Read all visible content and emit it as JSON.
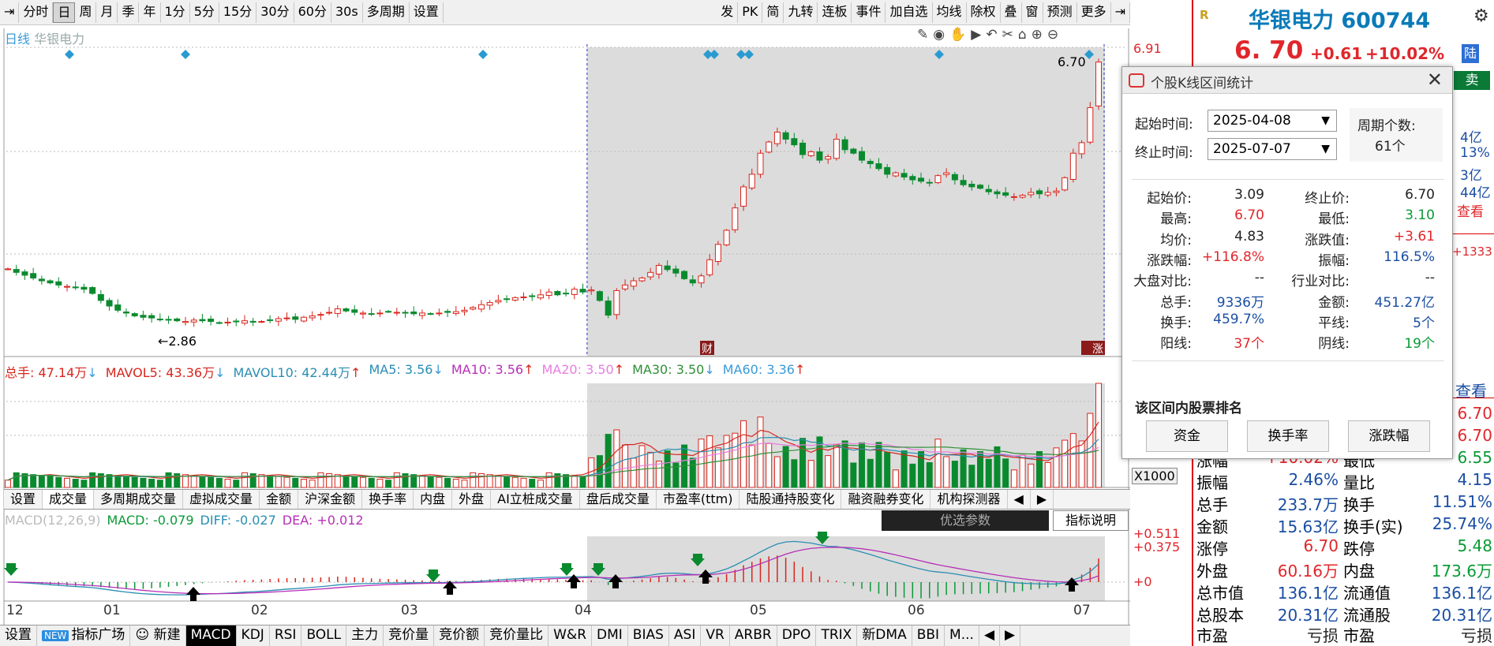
{
  "toolbar": {
    "left": [
      "分时",
      "日",
      "周",
      "月",
      "季",
      "年",
      "1分",
      "5分",
      "15分",
      "30分",
      "60分",
      "30s",
      "多周期",
      "设置"
    ],
    "right": [
      "发",
      "PK",
      "简",
      "九转",
      "连板",
      "事件",
      "加自选",
      "均线",
      "除权",
      "叠",
      "窗",
      "预测",
      "更多"
    ]
  },
  "chart": {
    "period_label": "日线",
    "stock_label": "华银电力",
    "low_marker": "2.86",
    "high_marker": "6.70",
    "cai_label": "财",
    "zhang_label": "涨"
  },
  "price_axis": {
    "top": "6.91",
    "vol_mult": "X1000",
    "macd_hi": "+0.511",
    "macd_mid": "+0.375",
    "macd_zero": "+0"
  },
  "vol_legend": [
    {
      "t": "总手: 47.14万",
      "c": "#d9251c",
      "arrow": "↓",
      "ac": "#3a9ad9"
    },
    {
      "t": "MAVOL5: 43.36万",
      "c": "#d9251c",
      "arrow": "↓",
      "ac": "#3a9ad9"
    },
    {
      "t": "MAVOL10: 42.44万",
      "c": "#2a8eb3",
      "arrow": "↑",
      "ac": "#d9251c"
    },
    {
      "t": "MA5: 3.56",
      "c": "#2a8eb3",
      "arrow": "↓",
      "ac": "#3a9ad9"
    },
    {
      "t": "MA10: 3.56",
      "c": "#b72fb7",
      "arrow": "↑",
      "ac": "#d9251c"
    },
    {
      "t": "MA20: 3.50",
      "c": "#e77ee0",
      "arrow": "↑",
      "ac": "#d9251c"
    },
    {
      "t": "MA30: 3.50",
      "c": "#2f8f37",
      "arrow": "↓",
      "ac": "#3a9ad9"
    },
    {
      "t": "MA60: 3.36",
      "c": "#3a9ad9",
      "arrow": "↑",
      "ac": "#d9251c"
    }
  ],
  "indicator_tabs": [
    "设置",
    "成交量",
    "多周期成交量",
    "虚拟成交量",
    "金额",
    "沪深金额",
    "换手率",
    "内盘",
    "外盘",
    "AI立桩成交量",
    "盘后成交量",
    "市盈率(ttm)",
    "陆股通持股变化",
    "融资融券变化",
    "机构探测器"
  ],
  "macd_legend": {
    "name": "MACD(12,26,9)",
    "macd": "MACD: -0.079",
    "diff": "DIFF: -0.027",
    "dea": "DEA: +0.012"
  },
  "macd_params": "优选参数",
  "macd_explain": "指标说明",
  "time_axis": [
    "12",
    "01",
    "02",
    "03",
    "04",
    "05",
    "06",
    "07"
  ],
  "bottom_tabs": [
    "设置",
    "指标广场",
    "新建",
    "MACD",
    "KDJ",
    "RSI",
    "BOLL",
    "主力",
    "竞价量",
    "竞价额",
    "竞价量比",
    "W&R",
    "DMI",
    "BIAS",
    "ASI",
    "VR",
    "ARBR",
    "DPO",
    "TRIX",
    "新DMA",
    "BBI",
    "M..."
  ],
  "new_badge": "NEW",
  "stock": {
    "name": "华银电力 600744",
    "badge": "R",
    "price": "6. 70",
    "change": "+0.61",
    "change_pct": "+10.02%",
    "exchange": "陆",
    "sell": "卖"
  },
  "quote_partial": [
    "4亿",
    "13%",
    "3亿",
    "44亿",
    "查看",
    "+1333",
    "查看"
  ],
  "quote_rows": [
    {
      "l1": "",
      "v1": "",
      "l2": "",
      "v2": "6.70"
    },
    {
      "l1": "",
      "v1": "",
      "l2": "",
      "v2": "6.70"
    },
    {
      "l1": "涨幅",
      "v1": "+10.02%",
      "l2": "最低",
      "v2": "6.55"
    },
    {
      "l1": "振幅",
      "v1": "2.46%",
      "l2": "量比",
      "v2": "4.15"
    },
    {
      "l1": "总手",
      "v1": "233.7万",
      "l2": "换手",
      "v2": "11.51%"
    },
    {
      "l1": "金额",
      "v1": "15.63亿",
      "l2": "换手(实)",
      "v2": "25.74%"
    },
    {
      "l1": "涨停",
      "v1": "6.70",
      "l2": "跌停",
      "v2": "5.48"
    },
    {
      "l1": "外盘",
      "v1": "60.16万",
      "l2": "内盘",
      "v2": "173.6万"
    },
    {
      "l1": "总市值",
      "v1": "136.1亿",
      "l2": "流通值",
      "v2": "136.1亿"
    },
    {
      "l1": "总股本",
      "v1": "20.31亿",
      "l2": "流通股",
      "v2": "20.31亿"
    },
    {
      "l1": "市盈(静)",
      "v1": "亏损",
      "l2": "市盈(TTM)",
      "v2": "亏损"
    }
  ],
  "popup": {
    "title": "个股K线区间统计",
    "start_label": "起始时间:",
    "start_value": "2025-04-08",
    "end_label": "终止时间:",
    "end_value": "2025-07-07",
    "period_count_label": "周期个数:",
    "period_count": "61个",
    "stats": [
      {
        "l": "起始价:",
        "v": "3.09",
        "vc": "#222",
        "l2": "终止价:",
        "v2": "6.70",
        "v2c": "#222"
      },
      {
        "l": "最高:",
        "v": "6.70",
        "vc": "#e0262b",
        "l2": "最低:",
        "v2": "3.10",
        "v2c": "#0a9a36"
      },
      {
        "l": "均价:",
        "v": "4.83",
        "vc": "#222",
        "l2": "涨跌值:",
        "v2": "+3.61",
        "v2c": "#e0262b"
      },
      {
        "l": "涨跌幅:",
        "v": "+116.8%",
        "vc": "#e0262b",
        "l2": "振幅:",
        "v2": "116.5%",
        "v2c": "#1a4ea3"
      },
      {
        "l": "大盘对比:",
        "v": "--",
        "vc": "#222",
        "l2": "行业对比:",
        "v2": "--",
        "v2c": "#222"
      },
      {
        "l": "总手:",
        "v": "9336万",
        "vc": "#1a4ea3",
        "l2": "金额:",
        "v2": "451.27亿",
        "v2c": "#1a4ea3"
      },
      {
        "l": "换手:",
        "v": "459.7%",
        "vc": "#1a4ea3",
        "l2": "平线:",
        "v2": "5个",
        "v2c": "#1a4ea3"
      },
      {
        "l": "阳线:",
        "v": "37个",
        "vc": "#e0262b",
        "l2": "阴线:",
        "v2": "19个",
        "v2c": "#0a9a36"
      }
    ],
    "rank_title": "该区间内股票排名",
    "rank_buttons": [
      "资金",
      "换手率",
      "涨跌幅"
    ]
  },
  "chart_data": {
    "type": "candlestick",
    "price_range": [
      2.5,
      6.91
    ],
    "selection": {
      "start": "2025-04-08",
      "end": "2025-07-07"
    },
    "closes": [
      3.75,
      3.7,
      3.66,
      3.62,
      3.58,
      3.55,
      3.52,
      3.5,
      3.48,
      3.46,
      3.4,
      3.3,
      3.22,
      3.16,
      3.12,
      3.08,
      3.06,
      3.05,
      3.03,
      3.02,
      3.01,
      3.0,
      3.02,
      3.01,
      3.0,
      2.98,
      2.99,
      3.0,
      3.01,
      2.99,
      3.0,
      3.02,
      3.04,
      3.05,
      3.03,
      3.06,
      3.08,
      3.1,
      3.13,
      3.18,
      3.15,
      3.13,
      3.12,
      3.11,
      3.12,
      3.14,
      3.13,
      3.12,
      3.11,
      3.12,
      3.11,
      3.12,
      3.13,
      3.14,
      3.16,
      3.2,
      3.24,
      3.27,
      3.3,
      3.32,
      3.34,
      3.35,
      3.36,
      3.38,
      3.42,
      3.38,
      3.4,
      3.46,
      3.42,
      3.45,
      3.3,
      3.09,
      3.44,
      3.52,
      3.58,
      3.62,
      3.7,
      3.8,
      3.74,
      3.69,
      3.61,
      3.55,
      3.65,
      3.88,
      4.1,
      4.3,
      4.62,
      4.92,
      5.1,
      5.4,
      5.56,
      5.7,
      5.6,
      5.52,
      5.38,
      5.42,
      5.3,
      5.35,
      5.6,
      5.45,
      5.4,
      5.3,
      5.25,
      5.18,
      5.1,
      5.12,
      5.06,
      5.02,
      5.0,
      4.98,
      5.08,
      5.12,
      5.02,
      4.95,
      4.92,
      4.9,
      4.85,
      4.82,
      4.8,
      4.78,
      4.8,
      4.84,
      4.82,
      4.84,
      4.86,
      5.05,
      5.4,
      5.55,
      6.05,
      6.7
    ]
  }
}
